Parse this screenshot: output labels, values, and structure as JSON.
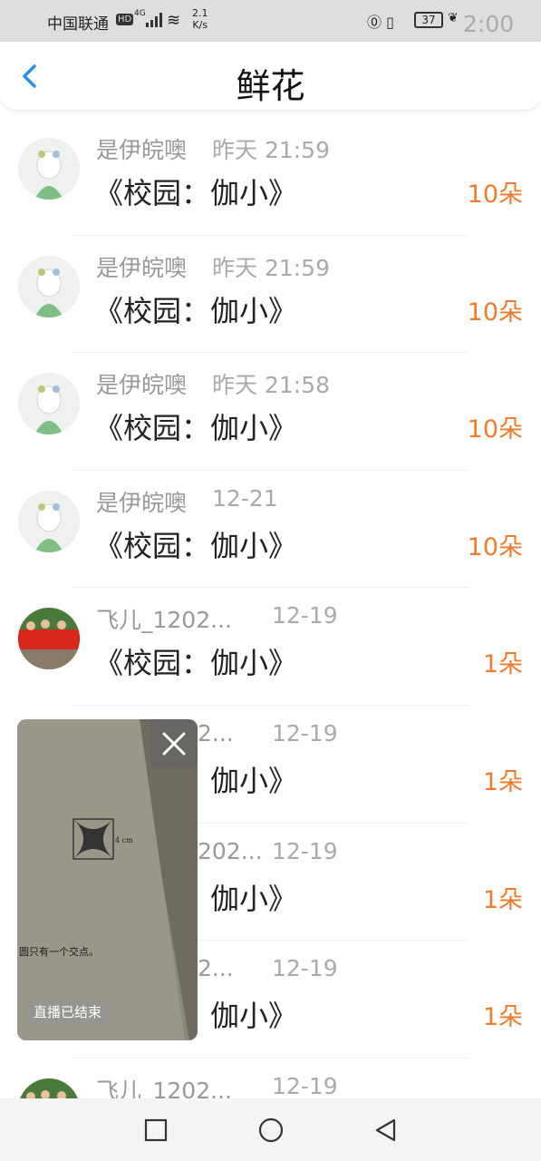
{
  "status_bar": {
    "carrier": "中国联通",
    "hd": "HD",
    "network": "4G",
    "speed_value": "2.1",
    "speed_unit": "K/s",
    "battery": "37",
    "time": "2:00"
  },
  "header": {
    "title": "鲜花",
    "back_icon": "chevron-left-icon"
  },
  "list": {
    "items": [
      {
        "name": "是伊皖噢",
        "time": "昨天 21:59",
        "content": "《校园：伽小》",
        "count": "10朵"
      },
      {
        "name": "是伊皖噢",
        "time": "昨天 21:59",
        "content": "《校园：伽小》",
        "count": "10朵"
      },
      {
        "name": "是伊皖噢",
        "time": "昨天 21:58",
        "content": "《校园：伽小》",
        "count": "10朵"
      },
      {
        "name": "是伊皖噢",
        "time": "12-21",
        "content": "《校园：伽小》",
        "count": "10朵"
      },
      {
        "name": "飞儿_1202...",
        "time": "12-19",
        "content": "《校园：伽小》",
        "count": "1朵"
      },
      {
        "name": "2...",
        "time": "12-19",
        "content": "伽小》",
        "count": "1朵"
      },
      {
        "name": "202...",
        "time": "12-19",
        "content": "伽小》",
        "count": "1朵"
      },
      {
        "name": "2...",
        "time": "12-19",
        "content": "伽小》",
        "count": "1朵"
      },
      {
        "name": "飞儿_1202...",
        "time": "12-19",
        "content": "",
        "count": ""
      }
    ]
  },
  "float_video": {
    "status_label": "直播已结束",
    "close_icon": "close-icon",
    "book_text": "圆只有一个交点。",
    "dim_label": "4 cm"
  },
  "colors": {
    "accent_blue": "#2a8fe6",
    "count_orange": "#f07b2c"
  }
}
